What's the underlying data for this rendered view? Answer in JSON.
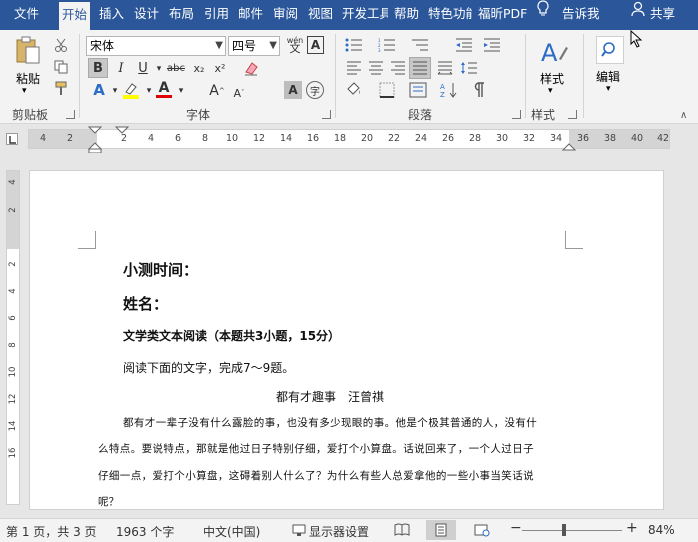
{
  "menubar": {
    "tabs": [
      "文件",
      "开始",
      "插入",
      "设计",
      "布局",
      "引用",
      "邮件",
      "审阅",
      "视图",
      "开发工具",
      "帮助",
      "特色功能",
      "福昕PDF"
    ],
    "active_tab": "开始",
    "tell_me": "告诉我",
    "share": "共享"
  },
  "ribbon": {
    "clipboard": {
      "paste_label": "粘贴",
      "group_label": "剪贴板"
    },
    "font": {
      "font_name": "宋体",
      "font_size": "四号",
      "group_label": "字体",
      "bold": "B",
      "italic": "I",
      "underline": "U",
      "strike": "abc",
      "sub": "x₂",
      "sup": "x²",
      "wen": "wén",
      "char_border": "A"
    },
    "paragraph": {
      "group_label": "段落"
    },
    "styles": {
      "label": "样式",
      "group_label": "样式"
    },
    "editing": {
      "label": "编辑"
    }
  },
  "ruler": {
    "numbers": [
      "4",
      "2",
      "2",
      "4",
      "6",
      "8",
      "10",
      "12",
      "14",
      "16",
      "18",
      "20",
      "22",
      "24",
      "26",
      "28",
      "30",
      "32",
      "34",
      "36",
      "38",
      "40",
      "42"
    ],
    "vnumbers": [
      "4",
      "2",
      "2",
      "4",
      "6",
      "8",
      "10",
      "12",
      "14",
      "16"
    ]
  },
  "document": {
    "line1": "小测时间：",
    "line2": "姓名：",
    "line3": "文学类文本阅读（本题共3小题，15分）",
    "line4": "阅读下面的文字，完成7～9题。",
    "title": "都有才趣事　汪曾祺",
    "para1": "都有才一辈子没有什么露脸的事，也没有多少现眼的事。他是个极其普通的人，没有什",
    "para2": "么特点。要说特点，那就是他过日子特别仔细，爱打个小算盘。话说回来了，一个人过日子",
    "para3": "仔细一点，爱打个小算盘，这碍着别人什么了？为什么有些人总爱拿他的一些小事当笑话说",
    "para4": "呢？"
  },
  "status": {
    "page": "第 1 页，共 3 页",
    "words": "1963 个字",
    "language": "中文(中国)",
    "display": "显示器设置",
    "zoom": "84%",
    "zoom_level": 0.84
  },
  "colors": {
    "brand": "#2b579a",
    "highlight": "#ffff00",
    "font_color": "#e00000"
  }
}
